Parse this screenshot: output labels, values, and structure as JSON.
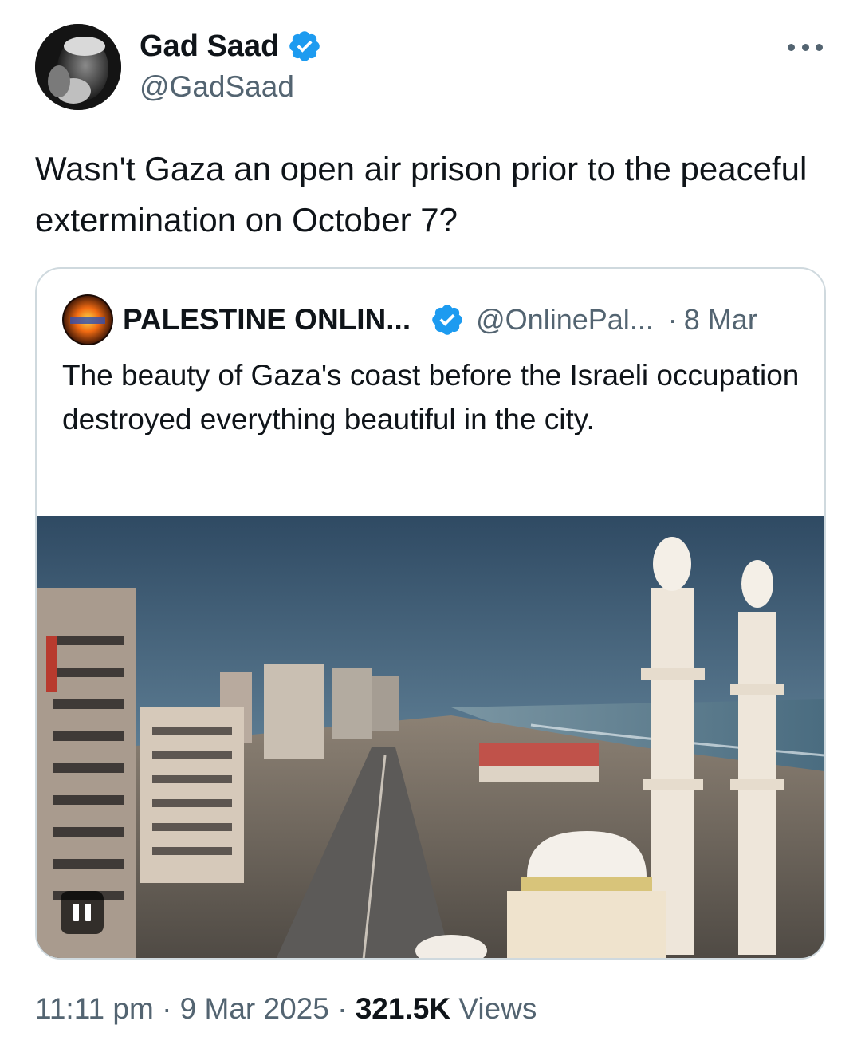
{
  "author": {
    "name": "Gad Saad",
    "handle": "@GadSaad"
  },
  "tweet": {
    "text": "Wasn't Gaza an open air prison prior to the peaceful extermination on October 7?"
  },
  "quoted": {
    "name": "PALESTINE ONLIN...",
    "handle": "@OnlinePal...",
    "separator": "·",
    "date": "8 Mar",
    "text": "The beauty of Gaza's coast before the Israeli occupation destroyed everything beautiful in the city."
  },
  "meta": {
    "time": "11:11 pm",
    "sep1": "·",
    "date": "9 Mar 2025",
    "sep2": "·",
    "views_count": "321.5K",
    "views_label": "Views"
  },
  "colors": {
    "verified": "#1d9bf0",
    "secondary_text": "#536471",
    "border": "#cfd9de"
  }
}
